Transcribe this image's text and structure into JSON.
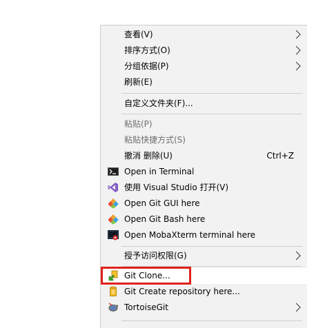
{
  "menu": {
    "items": [
      {
        "label": "查看(V)",
        "submenu": true
      },
      {
        "label": "排序方式(O)",
        "submenu": true
      },
      {
        "label": "分组依据(P)",
        "submenu": true
      },
      {
        "label": "刷新(E)"
      },
      {
        "label": "自定义文件夹(F)..."
      },
      {
        "label": "粘贴(P)",
        "disabled": true
      },
      {
        "label": "粘贴快捷方式(S)",
        "disabled": true
      },
      {
        "label": "撤消 删除(U)",
        "shortcut": "Ctrl+Z"
      },
      {
        "label": "Open in Terminal",
        "icon": "terminal-icon"
      },
      {
        "label": "使用 Visual Studio 打开(V)",
        "icon": "visual-studio-icon"
      },
      {
        "label": "Open Git GUI here",
        "icon": "git-gui-icon"
      },
      {
        "label": "Open Git Bash here",
        "icon": "git-bash-icon"
      },
      {
        "label": "Open MobaXterm terminal here",
        "icon": "mobaxterm-icon"
      },
      {
        "label": "授予访问权限(G)",
        "submenu": true
      },
      {
        "label": "Git Clone...",
        "icon": "git-clone-icon",
        "highlighted": true
      },
      {
        "label": "Git Create repository here...",
        "icon": "git-create-repo-icon"
      },
      {
        "label": "TortoiseGit",
        "icon": "tortoisegit-icon",
        "submenu": true
      }
    ]
  },
  "colors": {
    "menu_background": "#f2f2f2",
    "highlight_box": "#e0211b",
    "disabled_text": "#6d6d6d"
  }
}
